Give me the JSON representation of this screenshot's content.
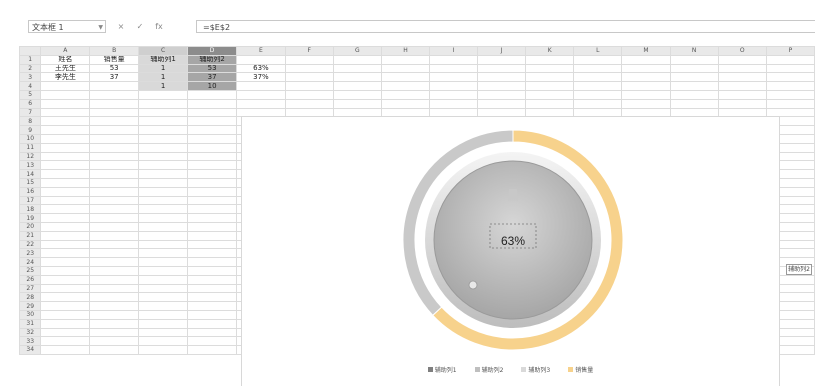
{
  "formula_bar": {
    "name_box": "文本框 1",
    "icons": [
      "×",
      "✓",
      "fx"
    ],
    "formula": "=$E$2"
  },
  "sheet": {
    "columns": [
      "A",
      "B",
      "C",
      "D",
      "E",
      "F",
      "G",
      "H",
      "I",
      "J",
      "K",
      "L",
      "M",
      "N",
      "O",
      "P"
    ],
    "rows": [
      [
        "姓名",
        "销售量",
        "辅助列1",
        "辅助列2",
        "",
        "",
        "",
        "",
        "",
        "",
        "",
        "",
        "",
        "",
        "",
        ""
      ],
      [
        "王先生",
        "53",
        "1",
        "53",
        "63%",
        "",
        "",
        "",
        "",
        "",
        "",
        "",
        "",
        "",
        "",
        ""
      ],
      [
        "李先生",
        "37",
        "1",
        "37",
        "37%",
        "",
        "",
        "",
        "",
        "",
        "",
        "",
        "",
        "",
        "",
        ""
      ],
      [
        "",
        "",
        "1",
        "10",
        "",
        "",
        "",
        "",
        "",
        "",
        "",
        "",
        "",
        "",
        "",
        ""
      ],
      [
        "",
        "",
        "",
        "",
        "",
        "",
        "",
        "",
        "",
        "",
        "",
        "",
        "",
        "",
        "",
        ""
      ]
    ],
    "row_count": 34
  },
  "chart": {
    "center_label": "63%",
    "legend": [
      "辅助列1",
      "辅助列2",
      "辅助列3",
      "销售量"
    ],
    "ring_orange": "#f7d28c",
    "ring_gray": "#c9c9c9",
    "inner_gray": "#b0b0b0"
  },
  "side_tag": "辅助列2",
  "chart_data": {
    "type": "pie",
    "categories": [
      "王先生",
      "李先生"
    ],
    "values": [
      63,
      37
    ]
  }
}
